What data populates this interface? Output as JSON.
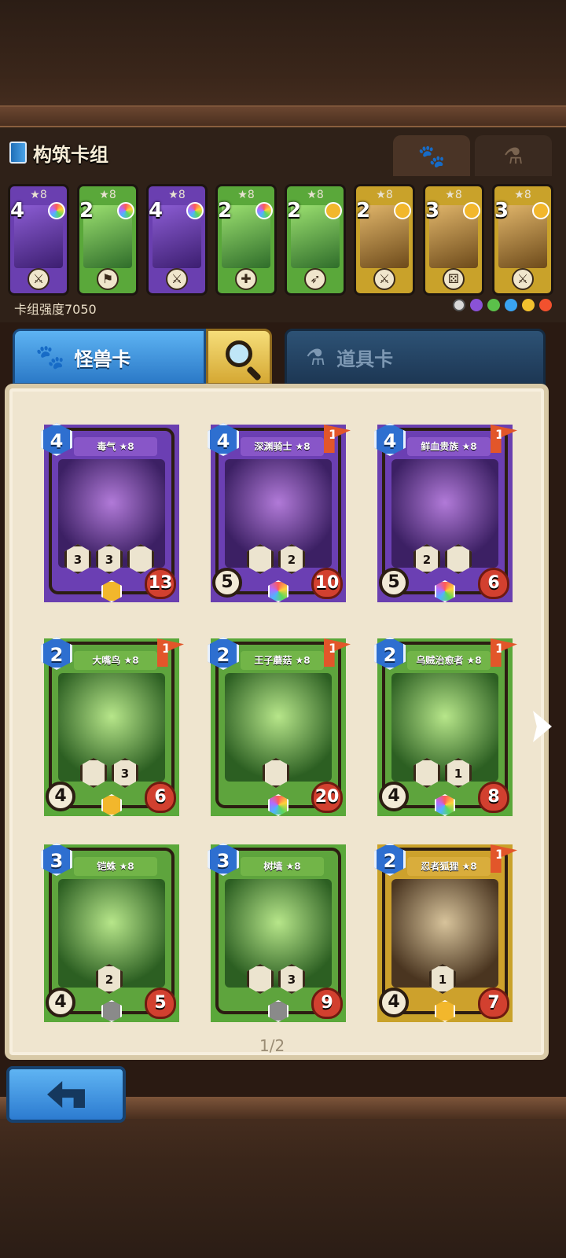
{
  "header": {
    "title": "构筑卡组",
    "deck_power_label": "卡组强度7050",
    "tabs": [
      {
        "name": "monster-tab-icon",
        "icon": "paw-icon",
        "active": true
      },
      {
        "name": "item-tab-icon",
        "icon": "potion-icon",
        "active": false
      }
    ]
  },
  "deck": [
    {
      "cost": "4",
      "stars": "★8",
      "color": "purple",
      "gem": "rainbow",
      "role": "⚔"
    },
    {
      "cost": "2",
      "stars": "★8",
      "color": "green",
      "gem": "rainbow",
      "role": "⚑"
    },
    {
      "cost": "4",
      "stars": "★8",
      "color": "purple",
      "gem": "rainbow",
      "role": "⚔"
    },
    {
      "cost": "2",
      "stars": "★8",
      "color": "green",
      "gem": "rainbow",
      "role": "✚"
    },
    {
      "cost": "2",
      "stars": "★8",
      "color": "green",
      "gem": "gold",
      "role": "➶"
    },
    {
      "cost": "2",
      "stars": "★8",
      "color": "gold",
      "gem": "gold",
      "role": "⚔"
    },
    {
      "cost": "3",
      "stars": "★8",
      "color": "gold",
      "gem": "gold",
      "role": "⚄"
    },
    {
      "cost": "3",
      "stars": "★8",
      "color": "gold",
      "gem": "gold",
      "role": "⚔"
    }
  ],
  "category": {
    "monster_label": "怪兽卡",
    "item_label": "道具卡"
  },
  "cards": [
    {
      "name": "毒气 ★8",
      "cost": "4",
      "color": "purple",
      "atk": "",
      "hp": "13",
      "flag": "",
      "gem": "gold",
      "skills": [
        {
          "v": "3"
        },
        {
          "v": "3"
        },
        {
          "v": ""
        }
      ]
    },
    {
      "name": "深渊骑士 ★8",
      "cost": "4",
      "color": "purple",
      "atk": "5",
      "hp": "10",
      "flag": "1",
      "gem": "rainbow",
      "skills": [
        {
          "v": ""
        },
        {
          "v": "2"
        }
      ]
    },
    {
      "name": "鲜血贵族 ★8",
      "cost": "4",
      "color": "purple",
      "atk": "5",
      "hp": "6",
      "flag": "1",
      "gem": "rainbow",
      "skills": [
        {
          "v": "2"
        },
        {
          "v": ""
        }
      ]
    },
    {
      "name": "大嘴鸟 ★8",
      "cost": "2",
      "color": "green",
      "atk": "4",
      "hp": "6",
      "flag": "1",
      "gem": "gold",
      "skills": [
        {
          "v": ""
        },
        {
          "v": "3"
        }
      ]
    },
    {
      "name": "王子蘑菇 ★8",
      "cost": "2",
      "color": "green",
      "atk": "",
      "hp": "20",
      "flag": "1",
      "gem": "rainbow",
      "skills": [
        {
          "v": ""
        }
      ]
    },
    {
      "name": "乌贼治愈者 ★8",
      "cost": "2",
      "color": "green",
      "atk": "4",
      "hp": "8",
      "flag": "1",
      "gem": "rainbow",
      "skills": [
        {
          "v": ""
        },
        {
          "v": "1"
        }
      ]
    },
    {
      "name": "铠蛛 ★8",
      "cost": "3",
      "color": "green",
      "atk": "4",
      "hp": "5",
      "flag": "",
      "gem": "gray",
      "skills": [
        {
          "v": "2"
        }
      ]
    },
    {
      "name": "树墙 ★8",
      "cost": "3",
      "color": "green",
      "atk": "",
      "hp": "9",
      "flag": "",
      "gem": "gray",
      "skills": [
        {
          "v": ""
        },
        {
          "v": "3"
        }
      ]
    },
    {
      "name": "忍者狐狸 ★8",
      "cost": "2",
      "color": "gold",
      "atk": "4",
      "hp": "7",
      "flag": "1",
      "gem": "gold",
      "skills": [
        {
          "v": "1"
        }
      ]
    }
  ],
  "pagination": {
    "label": "1/2"
  },
  "colors": {
    "purple": "#6b3fb3",
    "green": "#5ea43d",
    "gold": "#cda12c",
    "blue_tab": "#2b79c7"
  }
}
